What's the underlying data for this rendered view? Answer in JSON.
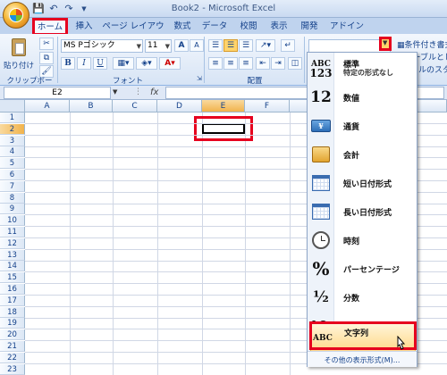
{
  "title": "Book2 - Microsoft Excel",
  "qat": {
    "save": "save-icon",
    "undo": "undo-icon",
    "redo": "redo-icon"
  },
  "tabs": [
    {
      "label": "ホーム",
      "active": true
    },
    {
      "label": "挿入"
    },
    {
      "label": "ページ レイアウト"
    },
    {
      "label": "数式"
    },
    {
      "label": "データ"
    },
    {
      "label": "校閲"
    },
    {
      "label": "表示"
    },
    {
      "label": "開発"
    },
    {
      "label": "アドイン"
    }
  ],
  "ribbon": {
    "clipboard": {
      "paste_label": "貼り付け",
      "group_label": "クリップボード"
    },
    "font": {
      "name": "MS Pゴシック",
      "size": "11",
      "bold": "B",
      "italic": "I",
      "underline": "U",
      "grow": "A",
      "shrink": "A",
      "color": "A",
      "group_label": "フォント"
    },
    "alignment": {
      "group_label": "配置"
    },
    "number": {
      "format_value": "",
      "conditional": "条件付き書式",
      "table": "テーブルとして",
      "styles": "ルのスタイル"
    }
  },
  "formula_bar": {
    "name_box": "E2",
    "fx": "fx"
  },
  "grid": {
    "columns": [
      "A",
      "B",
      "C",
      "D",
      "E",
      "F"
    ],
    "rows": [
      "1",
      "2",
      "3",
      "4",
      "5",
      "6",
      "7",
      "8",
      "9",
      "10",
      "11",
      "12",
      "13",
      "14",
      "15",
      "16",
      "17",
      "18",
      "19",
      "20",
      "21",
      "22",
      "23"
    ],
    "selected_cell": "E2"
  },
  "number_format_menu": {
    "items": [
      {
        "icon": "ABC123",
        "label": "標準",
        "sub": "特定の形式なし"
      },
      {
        "icon": "12",
        "label": "数値"
      },
      {
        "icon": "currency-icon",
        "label": "通貨"
      },
      {
        "icon": "accounting-icon",
        "label": "会計"
      },
      {
        "icon": "calendar-icon",
        "label": "短い日付形式"
      },
      {
        "icon": "calendar-icon",
        "label": "長い日付形式"
      },
      {
        "icon": "clock-icon",
        "label": "時刻"
      },
      {
        "icon": "%",
        "label": "パーセンテージ"
      },
      {
        "icon": "1/2",
        "label": "分数"
      },
      {
        "icon": "10²",
        "label": "指数"
      },
      {
        "icon": "ABC",
        "label": "文字列",
        "highlighted": true
      }
    ],
    "more": "その他の表示形式(M)..."
  }
}
